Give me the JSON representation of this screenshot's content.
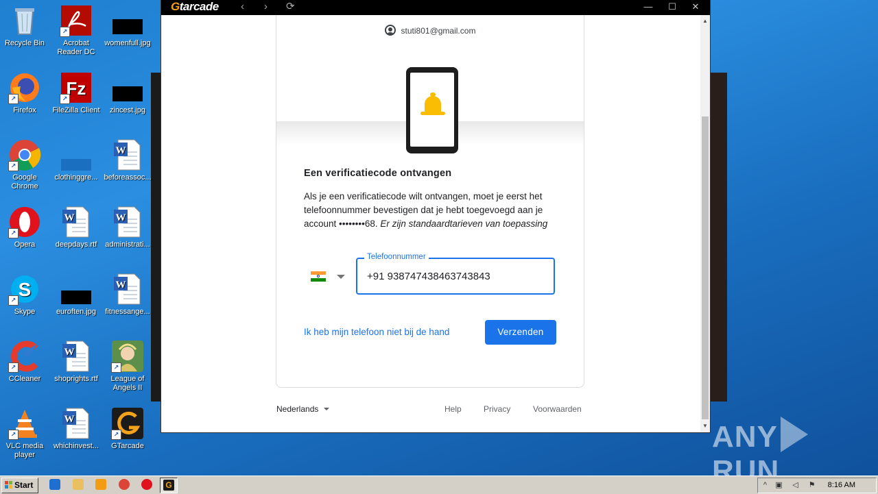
{
  "desktop": {
    "icons": [
      {
        "label": "Recycle Bin"
      },
      {
        "label": "Acrobat Reader DC"
      },
      {
        "label": "womenfull.jpg"
      },
      {
        "label": "Firefox"
      },
      {
        "label": "FileZilla Client"
      },
      {
        "label": "zincest.jpg"
      },
      {
        "label": "Google Chrome"
      },
      {
        "label": "clothinggre..."
      },
      {
        "label": "beforeassoc..."
      },
      {
        "label": "Opera"
      },
      {
        "label": "deepdays.rtf"
      },
      {
        "label": "administrati..."
      },
      {
        "label": "Skype"
      },
      {
        "label": "euroften.jpg"
      },
      {
        "label": "fitnessange..."
      },
      {
        "label": "CCleaner"
      },
      {
        "label": "shoprights.rtf"
      },
      {
        "label": "League of Angels II"
      },
      {
        "label": "VLC media player"
      },
      {
        "label": "whichinvest..."
      },
      {
        "label": "GTarcade"
      }
    ]
  },
  "window": {
    "logo_g": "G",
    "logo_rest": "tarcade",
    "back": "‹",
    "forward": "›",
    "refresh": "⟳",
    "minimize": "—",
    "maximize": "☐",
    "close": "✕"
  },
  "card": {
    "account_email": "stuti801@gmail.com",
    "heading": "Een verificatiecode ontvangen",
    "desc_text": "Als je een verificatiecode wilt ontvangen, moet je eerst het telefoonnummer bevestigen dat je hebt toegevoegd aan je account ••••••••68. ",
    "desc_italic": "Er zijn standaardtarieven van toepassing",
    "phone_label": "Telefoonnummer",
    "phone_value": "+91 938747438463743843",
    "no_phone_link": "Ik heb mijn telefoon niet bij de hand",
    "send_button": "Verzenden"
  },
  "footer": {
    "language": "Nederlands",
    "help": "Help",
    "privacy": "Privacy",
    "terms": "Voorwaarden"
  },
  "taskbar": {
    "start": "Start",
    "clock": "8:16 AM"
  },
  "watermark": {
    "left": "ANY",
    "right": "RUN"
  },
  "colors": {
    "accent": "#1a73e8",
    "bell": "#fbbc04",
    "logo": "#f3a21b"
  }
}
